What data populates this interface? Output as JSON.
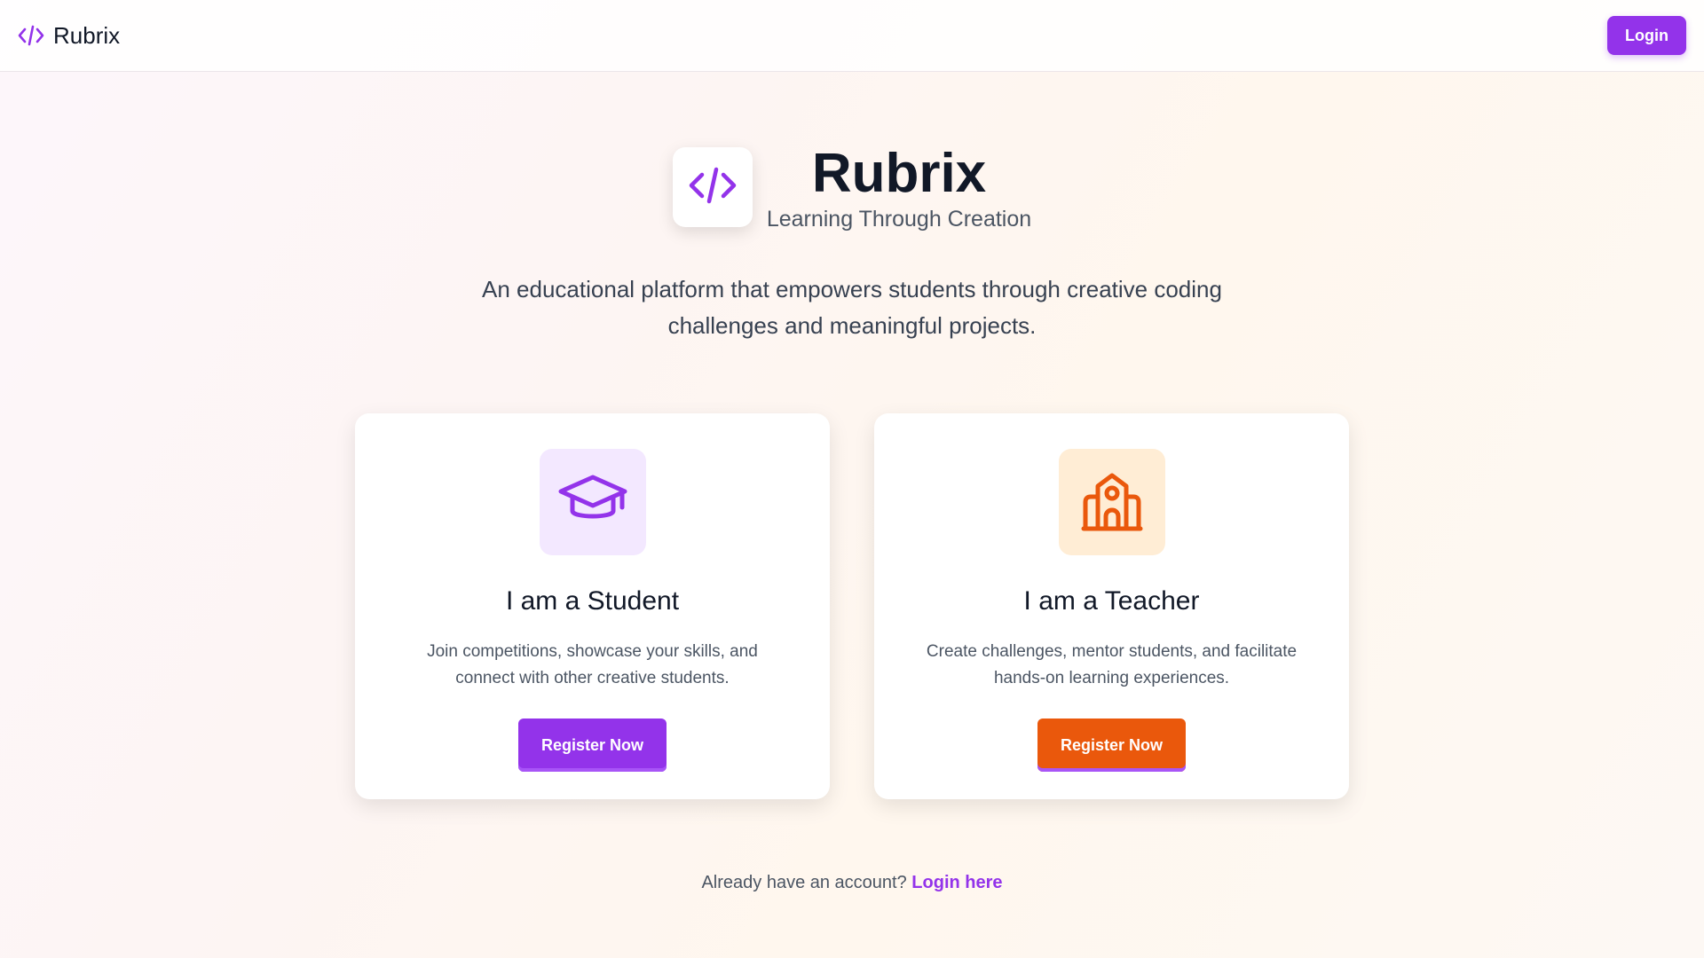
{
  "header": {
    "brand_name": "Rubrix",
    "login_label": "Login",
    "brand_icon": "code-icon"
  },
  "hero": {
    "title": "Rubrix",
    "subtitle": "Learning Through Creation",
    "logo_icon": "code-icon",
    "description_line1": "An educational platform that empowers students through creative coding",
    "description_line2": "challenges and meaningful projects."
  },
  "cards": [
    {
      "icon": "graduation-cap-icon",
      "title": "I am a Student",
      "desc_line1": "Join competitions, showcase your skills, and",
      "desc_line2": "connect with other creative students.",
      "button_label": "Register Now"
    },
    {
      "icon": "school-icon",
      "title": "I am a Teacher",
      "desc_line1": "Create challenges, mentor students, and facilitate",
      "desc_line2": "hands-on learning experiences.",
      "button_label": "Register Now"
    }
  ],
  "footer": {
    "prompt": "Already have an account?",
    "link_label": "Login here"
  },
  "colors": {
    "purple": "#9333ea",
    "orange": "#ea580c",
    "purple_light": "#f3e8ff",
    "orange_light": "#ffedd5"
  }
}
